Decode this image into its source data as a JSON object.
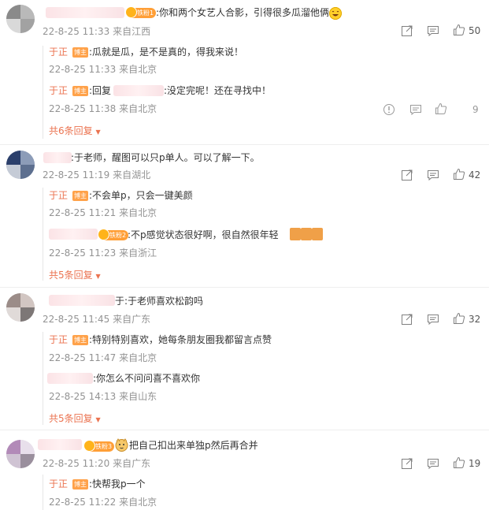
{
  "comments": [
    {
      "fan_badge": "铁粉1",
      "text": ":你和两个女艺人合影，引得很多瓜溜他俩",
      "time": "22-8-25 11:33",
      "location": "来自江西",
      "likes": "50",
      "replies": [
        {
          "name": "于正",
          "badge": "博主",
          "text": ":瓜就是瓜，是不是真的，得我来说！",
          "time": "22-8-25 11:33",
          "location": "来自北京"
        },
        {
          "name": "于正",
          "badge": "博主",
          "text_prefix": ":回复",
          "text": ":没定完呢！还在寻找中！",
          "time": "22-8-25 11:38",
          "location": "来自北京",
          "likes": "9"
        }
      ],
      "more": "共6条回复"
    },
    {
      "text": ":于老师，醒图可以只p单人。可以了解一下。",
      "time": "22-8-25 11:19",
      "location": "来自湖北",
      "likes": "42",
      "replies": [
        {
          "name": "于正",
          "badge": "博主",
          "text": ":不会单p，只会一键美颜",
          "time": "22-8-25 11:21",
          "location": "来自北京"
        },
        {
          "fan_badge": "铁粉2",
          "text": ":不p感觉状态很好啊，很自然很年轻",
          "time": "22-8-25 11:23",
          "location": "来自浙江"
        }
      ],
      "more": "共5条回复"
    },
    {
      "text": "于:于老师喜欢松韵吗",
      "time": "22-8-25 11:45",
      "location": "来自广东",
      "likes": "32",
      "replies": [
        {
          "name": "于正",
          "badge": "博主",
          "text": ":特别特别喜欢，她每条朋友圈我都留言点赞",
          "time": "22-8-25 11:47",
          "location": "来自北京"
        },
        {
          "text": ":你怎么不问问喜不喜欢你",
          "time": "22-8-25 14:13",
          "location": "来自山东"
        }
      ],
      "more": "共5条回复"
    },
    {
      "fan_badge": "铁粉3",
      "text": "把自己扣出来单独p然后再合并",
      "time": "22-8-25 11:20",
      "location": "来自广东",
      "likes": "19",
      "replies": [
        {
          "name": "于正",
          "badge": "博主",
          "text": ":快帮我p一个",
          "time": "22-8-25 11:22",
          "location": "来自北京"
        }
      ]
    }
  ],
  "colors": {
    "accent": "#eb7350",
    "meta": "#939393",
    "fan_badge": "#ff9f37"
  },
  "icons": [
    "share-icon",
    "comment-icon",
    "like-icon",
    "laugh-emoji-icon",
    "chevron-down-icon"
  ]
}
